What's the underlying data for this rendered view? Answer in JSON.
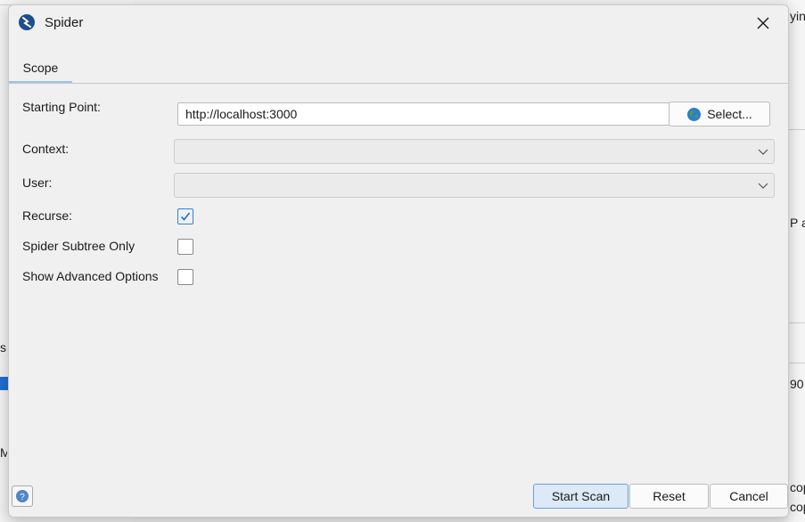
{
  "background": {
    "frag_top_right": "ying",
    "frag_mid_right": "P ar",
    "frag_num_right": "90",
    "frag_left_s": "s",
    "frag_left_m": "M",
    "frag_bottom_right_1": "cop",
    "frag_bottom_right_2": "cop"
  },
  "dialog": {
    "title": "Spider",
    "tabs": [
      {
        "label": "Scope"
      }
    ],
    "fields": {
      "starting_point": {
        "label": "Starting Point:",
        "value": "http://localhost:3000"
      },
      "context": {
        "label": "Context:",
        "value": ""
      },
      "user": {
        "label": "User:",
        "value": ""
      },
      "recurse": {
        "label": "Recurse:",
        "checked": true
      },
      "subtree_only": {
        "label": "Spider Subtree Only",
        "checked": false
      },
      "advanced": {
        "label": "Show Advanced Options",
        "checked": false
      }
    },
    "select_button": {
      "label": "Select...",
      "icon": "globe-icon"
    },
    "footer": {
      "start_scan": "Start Scan",
      "reset": "Reset",
      "cancel": "Cancel"
    }
  },
  "colors": {
    "accent": "#3d7fc4",
    "primary_button_bg": "#dce9f7",
    "tab_underline": "#9cc4ea"
  }
}
